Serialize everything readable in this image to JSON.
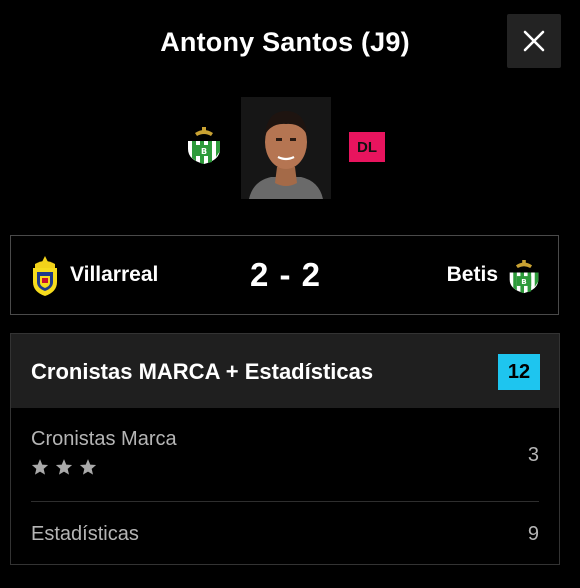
{
  "header": {
    "title": "Antony Santos (J9)"
  },
  "player": {
    "team_crest_icon": "betis-crest-icon",
    "photo": "player-photo",
    "position": "DL",
    "position_color": "#e8145e"
  },
  "match": {
    "home_team": "Villarreal",
    "score": "2 - 2",
    "away_team": "Betis"
  },
  "ratings": {
    "title": "Cronistas MARCA + Estadísticas",
    "total": "12",
    "total_color": "#1ec5ef",
    "rows": [
      {
        "label": "Cronistas Marca",
        "value": "3",
        "stars": 3
      },
      {
        "label": "Estadísticas",
        "value": "9"
      }
    ]
  }
}
